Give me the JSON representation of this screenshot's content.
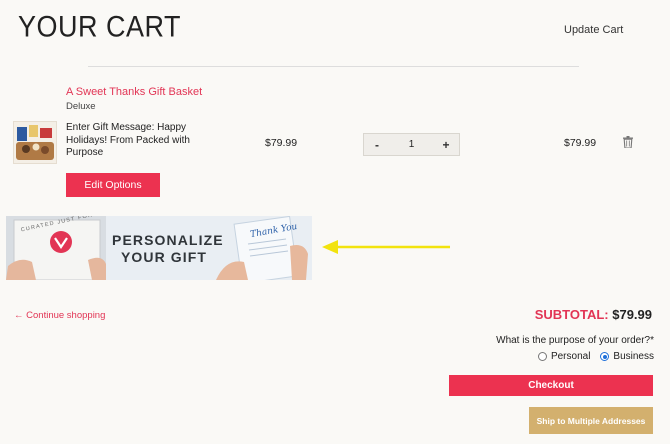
{
  "cart": {
    "title": "YOUR CART",
    "update_label": "Update Cart"
  },
  "item": {
    "name": "A Sweet Thanks Gift Basket",
    "variant": "Deluxe",
    "gift_message": "Enter Gift Message: Happy Holidays! From Packed with Purpose",
    "unit_price": "$79.99",
    "quantity": "1",
    "qty_minus": "-",
    "qty_plus": "+",
    "line_total": "$79.99",
    "edit_label": "Edit Options"
  },
  "banner": {
    "line1": "PERSONALIZE",
    "line2": "YOUR GIFT",
    "seal_text": "CURATED JUST FOR YOU",
    "card_text": "Thank You",
    "arrow_color": "#f2e30d"
  },
  "footer": {
    "continue_label": "← Continue shopping",
    "subtotal_label": "SUBTOTAL:",
    "subtotal_value": "$79.99",
    "purpose_question": "What is the purpose of your order?*",
    "option_personal": "Personal",
    "option_business": "Business",
    "selected_option": "Business",
    "checkout_label": "Checkout",
    "ship_label": "Ship to Multiple Addresses"
  },
  "colors": {
    "accent": "#ec3250",
    "gold": "#d3b06e",
    "background": "#faf9f6"
  }
}
